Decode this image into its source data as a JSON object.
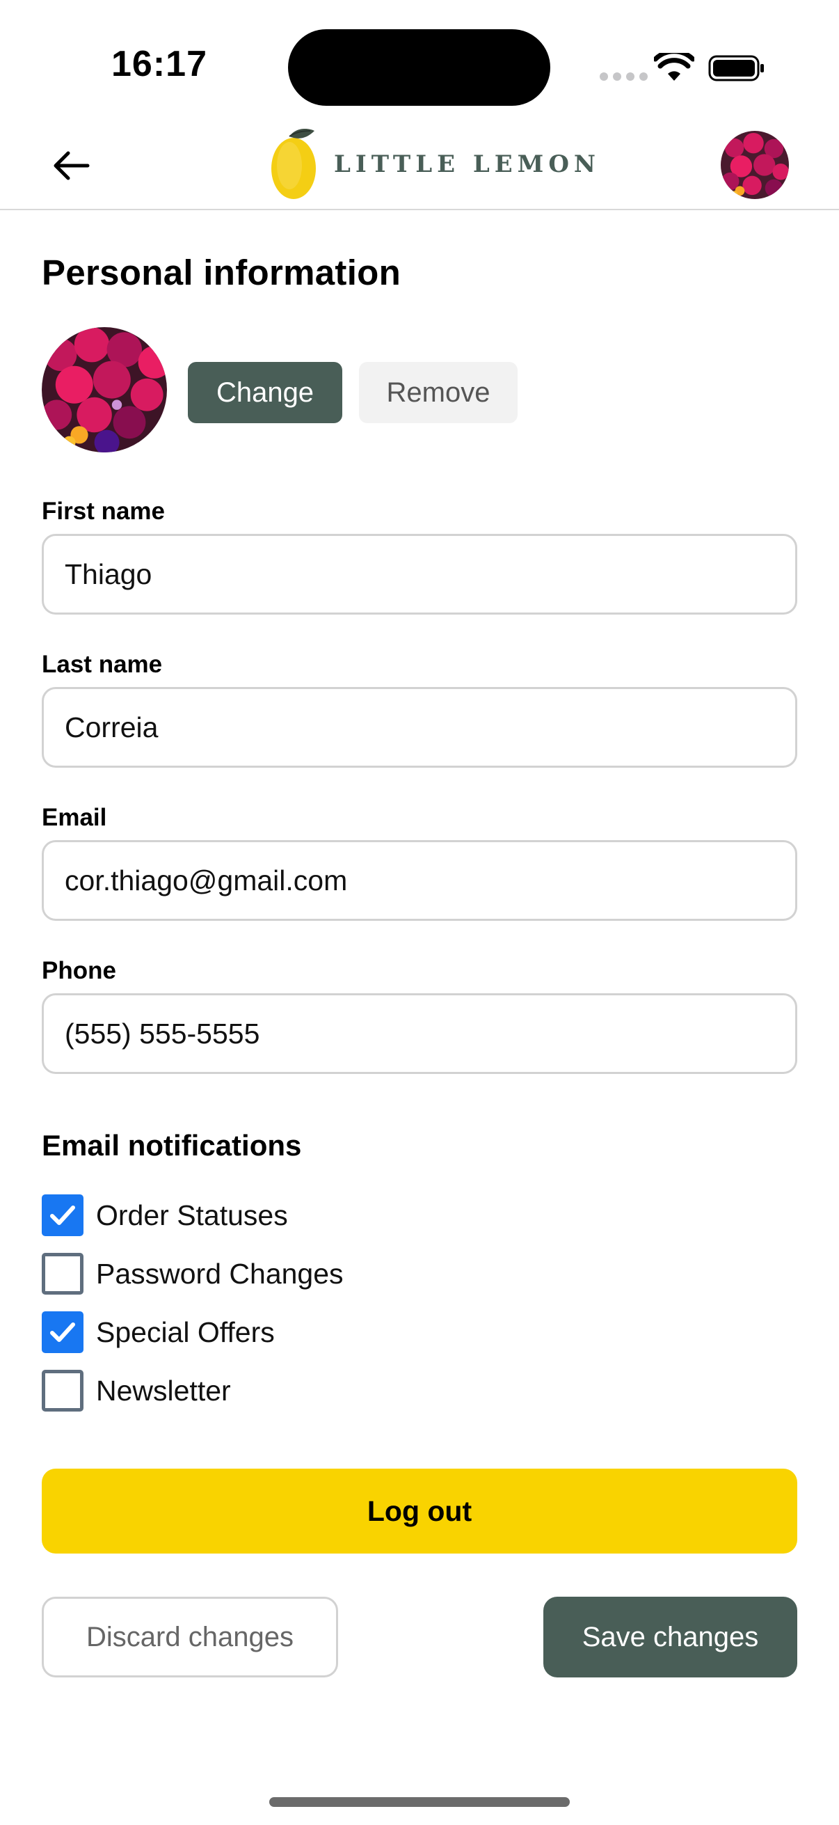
{
  "status_bar": {
    "time": "16:17"
  },
  "header": {
    "back_icon": "arrow-left-icon",
    "logo_text": "LITTLE LEMON",
    "brand_color": "#495e57"
  },
  "profile": {
    "section_title": "Personal information",
    "change_label": "Change",
    "remove_label": "Remove",
    "fields": [
      {
        "label": "First name",
        "value": "Thiago"
      },
      {
        "label": "Last name",
        "value": "Correia"
      },
      {
        "label": "Email",
        "value": "cor.thiago@gmail.com"
      },
      {
        "label": "Phone",
        "value": "(555) 555-5555"
      }
    ]
  },
  "notifications": {
    "title": "Email notifications",
    "items": [
      {
        "label": "Order Statuses",
        "checked": true
      },
      {
        "label": "Password Changes",
        "checked": false
      },
      {
        "label": "Special Offers",
        "checked": true
      },
      {
        "label": "Newsletter",
        "checked": false
      }
    ],
    "check_color": "#1877f2"
  },
  "actions": {
    "logout_label": "Log out",
    "discard_label": "Discard changes",
    "save_label": "Save changes",
    "logout_color": "#f9d300"
  }
}
